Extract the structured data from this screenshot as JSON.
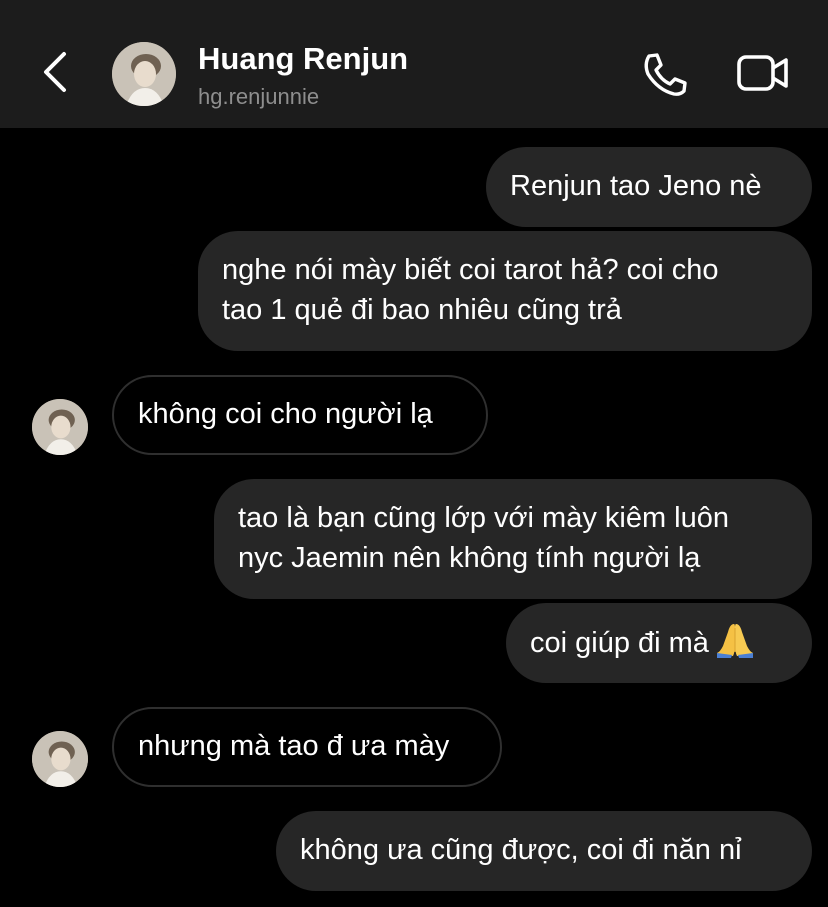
{
  "header": {
    "name": "Huang Renjun",
    "username": "hg.renjunnie",
    "icons": {
      "back": "chevron-left-icon",
      "call": "phone-icon",
      "video": "video-camera-icon"
    }
  },
  "messages": [
    {
      "direction": "outgoing",
      "lines": [
        "Renjun tao Jeno nè"
      ]
    },
    {
      "direction": "outgoing",
      "lines": [
        "nghe nói mày biết coi tarot hả? coi cho",
        "tao 1 quẻ đi bao nhiêu cũng trả"
      ]
    },
    {
      "direction": "incoming",
      "lines": [
        "không coi cho người lạ"
      ]
    },
    {
      "direction": "outgoing",
      "lines": [
        "tao là bạn cũng lớp với mày kiêm luôn",
        "nyc Jaemin nên không tính người lạ"
      ]
    },
    {
      "direction": "outgoing",
      "lines": [
        "coi giúp đi mà"
      ],
      "emoji": "folded-hands-emoji"
    },
    {
      "direction": "incoming",
      "lines": [
        "nhưng mà tao đ ưa mày"
      ]
    },
    {
      "direction": "outgoing",
      "lines": [
        "không ưa cũng được, coi đi năn nỉ"
      ]
    }
  ],
  "colors": {
    "background": "#000000",
    "header": "#1c1c1c",
    "outgoing_bubble": "#262626",
    "incoming_border": "#2f2f2f",
    "username": "#8e8e8e"
  }
}
